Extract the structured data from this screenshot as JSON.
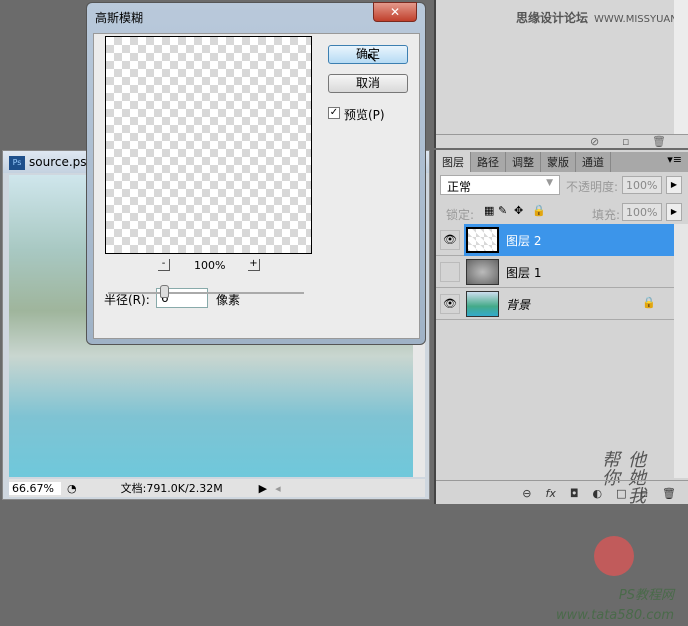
{
  "top_panel": {
    "watermark": "思缘设计论坛",
    "watermark_url": "WWW.MISSYUAN.COM",
    "footer_icons": [
      "no-icon",
      "new-icon",
      "trash-icon"
    ]
  },
  "layers_panel": {
    "tabs": [
      "图层",
      "路径",
      "调整",
      "蒙版",
      "通道"
    ],
    "active_tab": "图层",
    "blend_mode": "正常",
    "opacity_label": "不透明度:",
    "opacity": "100%",
    "lock_label": "锁定:",
    "fill_label": "填充:",
    "fill": "100%",
    "layers": [
      {
        "name": "图层 2",
        "visible": true,
        "selected": true
      },
      {
        "name": "图层 1",
        "visible": false,
        "selected": false
      },
      {
        "name": "背景",
        "visible": true,
        "selected": false,
        "locked": true
      }
    ],
    "bottom_icons": [
      "link-icon",
      "fx-icon",
      "mask-icon",
      "adjustment-icon",
      "group-icon",
      "new-layer-icon",
      "trash-icon"
    ],
    "accent": "#3c95ea"
  },
  "watermark": {
    "signature": "他她我帮你",
    "site": "PS教程网",
    "url": "www.tata580.com"
  },
  "document": {
    "title": "source.psd",
    "zoom": "66.67%",
    "doc_info": "文档:791.0K/2.32M"
  },
  "dialog": {
    "title": "高斯模糊",
    "close": "✕",
    "ok": "确定",
    "cancel": "取消",
    "preview_label": "预览(P)",
    "preview_checked": true,
    "zoom_minus": "-",
    "zoom_plus": "+",
    "zoom": "100%",
    "radius_label": "半径(R):",
    "radius": "6",
    "unit": "像素"
  }
}
